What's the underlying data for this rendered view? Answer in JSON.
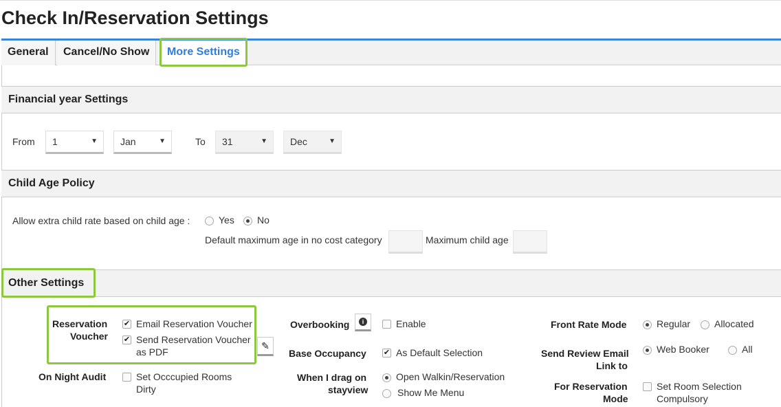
{
  "page_title": "Check In/Reservation Settings",
  "tabs": [
    {
      "label": "General"
    },
    {
      "label": "Cancel/No Show"
    },
    {
      "label": "More Settings"
    }
  ],
  "financial_year": {
    "title": "Financial year Settings",
    "from_label": "From",
    "from_day": "1",
    "from_month": "Jan",
    "to_label": "To",
    "to_day": "31",
    "to_month": "Dec"
  },
  "child_age": {
    "title": "Child Age Policy",
    "question": "Allow extra child rate based on child age :",
    "yes": "Yes",
    "no": "No",
    "selected": "No",
    "default_max_label": "Default maximum age in no cost category",
    "default_max_value": "",
    "max_child_label": "Maximum child age",
    "max_child_value": ""
  },
  "other": {
    "title": "Other Settings",
    "reservation_voucher_l1": "Reservation",
    "reservation_voucher_l2": "Voucher",
    "email_voucher": "Email Reservation Voucher",
    "pdf_voucher_l1": "Send Reservation Voucher",
    "pdf_voucher_l2": "as PDF",
    "night_audit": "On Night Audit",
    "occupied_dirty_l1": "Set Occcupied Rooms",
    "occupied_dirty_l2": "Dirty",
    "overbooking": "Overbooking",
    "enable": "Enable",
    "base_occupancy": "Base Occupancy",
    "as_default": "As Default Selection",
    "drag_l1": "When I drag on",
    "drag_l2": "stayview",
    "open_walkin": "Open Walkin/Reservation",
    "show_menu": "Show Me Menu",
    "front_rate": "Front Rate Mode",
    "regular": "Regular",
    "allocated": "Allocated",
    "review_l1": "Send Review Email",
    "review_l2": "Link to",
    "web_booker": "Web Booker",
    "all": "All",
    "room_sel_l1": "For Reservation",
    "room_sel_l2": "Mode",
    "room_compulsory_l1": "Set Room Selection",
    "room_compulsory_l2": "Compulsory"
  },
  "accent_color": "#2e7de1",
  "highlight_color": "#8dc63f"
}
